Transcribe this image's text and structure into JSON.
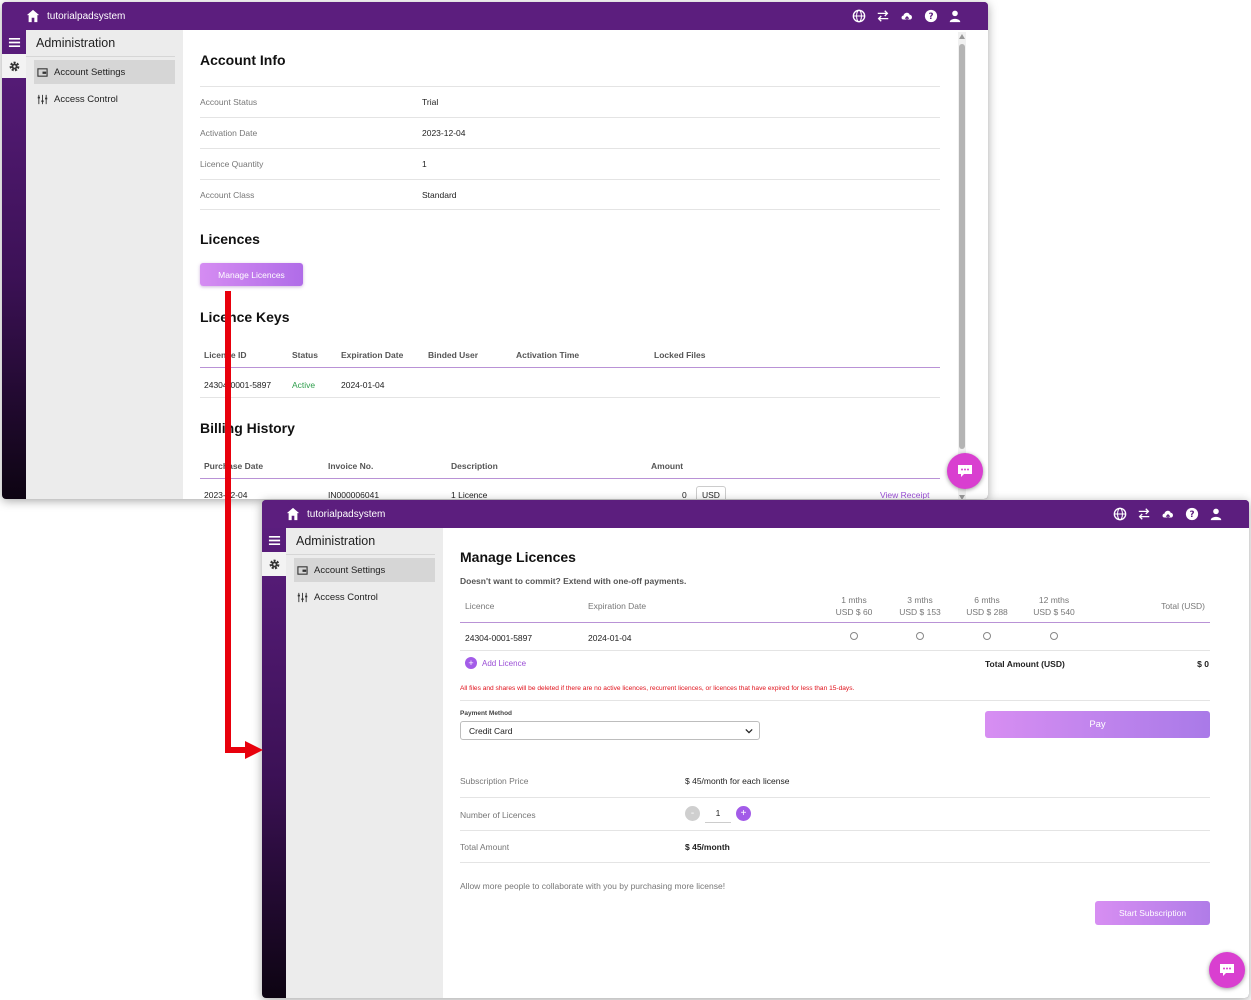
{
  "app": {
    "brand": "tutorialpadsystem"
  },
  "sidebar": {
    "title": "Administration",
    "items": [
      {
        "label": "Account Settings",
        "icon": "wallet-icon",
        "active": true
      },
      {
        "label": "Access Control",
        "icon": "sliders-icon",
        "active": false
      }
    ]
  },
  "topbar_icons": [
    "globe-icon",
    "swap-icon",
    "cloud-upload-icon",
    "help-icon",
    "user-icon"
  ],
  "account": {
    "section_title": "Account Info",
    "rows": [
      {
        "key": "Account Status",
        "value": "Trial"
      },
      {
        "key": "Activation Date",
        "value": "2023-12-04"
      },
      {
        "key": "Licence Quantity",
        "value": "1"
      },
      {
        "key": "Account Class",
        "value": "Standard"
      }
    ]
  },
  "licences": {
    "section_title": "Licences",
    "manage_button": "Manage Licences"
  },
  "licence_keys": {
    "section_title": "Licence Keys",
    "headers": [
      "Licence ID",
      "Status",
      "Expiration Date",
      "Binded User",
      "Activation Time",
      "Locked Files"
    ],
    "rows": [
      {
        "id": "24304-0001-5897",
        "status": "Active",
        "expiration": "2024-01-04",
        "user": "",
        "activation": "",
        "locked": ""
      }
    ]
  },
  "billing": {
    "section_title": "Billing History",
    "headers": [
      "Purchase Date",
      "Invoice No.",
      "Description",
      "Amount"
    ],
    "rows": [
      {
        "date": "2023-12-04",
        "invoice": "IN000006041",
        "description": "1 Licence",
        "amount": "0",
        "currency": "USD",
        "link": "View Receipt"
      }
    ]
  },
  "manage": {
    "title": "Manage Licences",
    "subtitle": "Doesn't want to commit? Extend with one-off payments.",
    "headers": {
      "licence": "Licence",
      "expiration": "Expiration Date",
      "plans": [
        {
          "label": "1 mths",
          "price": "USD $ 60"
        },
        {
          "label": "3 mths",
          "price": "USD $ 153"
        },
        {
          "label": "6 mths",
          "price": "USD $ 288"
        },
        {
          "label": "12 mths",
          "price": "USD $ 540"
        }
      ],
      "total": "Total (USD)"
    },
    "rows": [
      {
        "licence": "24304-0001-5897",
        "expiration": "2024-01-04"
      }
    ],
    "add_licence": "Add Licence",
    "total_amount_label": "Total Amount (USD)",
    "total_amount_value": "$ 0",
    "warning": "All files and shares will be deleted if there are no active licences, recurrent licences, or licences that have expired for less than 15-days.",
    "payment_method_label": "Payment Method",
    "payment_method_value": "Credit Card",
    "pay_button": "Pay",
    "subscription": {
      "price_label": "Subscription Price",
      "price_value": "$ 45/month for each license",
      "number_label": "Number of Licences",
      "number_value": "1",
      "minus": "-",
      "plus": "+",
      "total_label": "Total Amount",
      "total_value": "$ 45/month",
      "note": "Allow more people to collaborate with you by purchasing more license!",
      "start_button": "Start Subscription"
    }
  },
  "colors": {
    "header": "#5c1e7e",
    "accent": "#b06ce8",
    "active_status": "#2e9e4c",
    "warning": "#e0101a",
    "arrow": "#e8000c",
    "chat": "#d93fd0"
  }
}
